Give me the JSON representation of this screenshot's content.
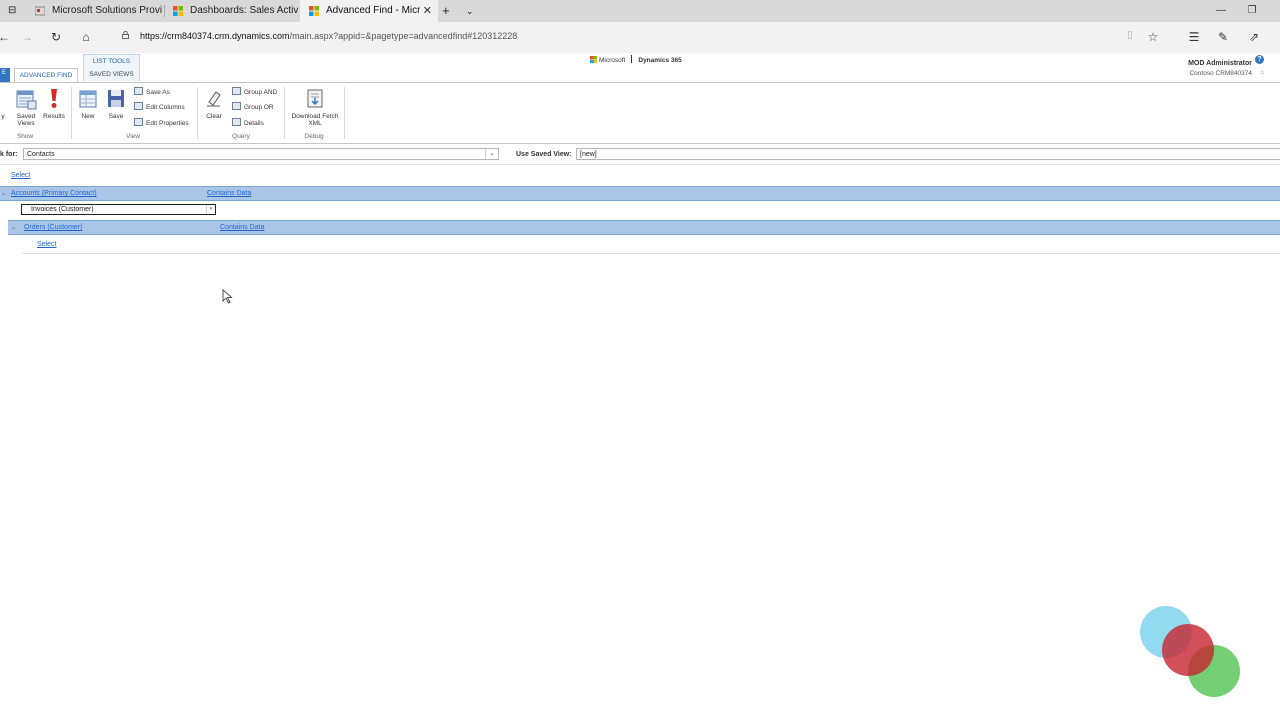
{
  "browser": {
    "tabs": [
      {
        "title": "Microsoft Solutions Provide",
        "active": false
      },
      {
        "title": "Dashboards: Sales Activity D",
        "active": false
      },
      {
        "title": "Advanced Find - Micros",
        "active": true
      }
    ],
    "url_host": "https://crm840374.crm.dynamics.com",
    "url_path": "/main.aspx?appid=&pagetype=advancedfind#120312228"
  },
  "header": {
    "brand_ms": "Microsoft",
    "brand_app": "Dynamics 365",
    "user_name": "MOD Administrator",
    "user_org": "Contoso CRM840374",
    "help": "?"
  },
  "ribbon": {
    "context_title": "LIST TOOLS",
    "context_tab": "SAVED VIEWS",
    "active_tab": "ADVANCED FIND",
    "file_tab": "E",
    "show": {
      "label": "Show",
      "partial": "y",
      "saved_views": "Saved Views",
      "results": "Results"
    },
    "view": {
      "label": "View",
      "new": "New",
      "save": "Save",
      "save_as": "Save As",
      "edit_columns": "Edit Columns",
      "edit_properties": "Edit Properties"
    },
    "query": {
      "label": "Query",
      "clear": "Clear",
      "group_and": "Group AND",
      "group_or": "Group OR",
      "details": "Details"
    },
    "debug": {
      "label": "Debug",
      "download_fetch": "Download Fetch XML"
    }
  },
  "look_for": {
    "label": "k for:",
    "value": "Contacts"
  },
  "saved_view": {
    "label": "Use Saved View:",
    "value": "[new]"
  },
  "query": {
    "top_select": "Select",
    "row1": {
      "field": "Accounts (Primary Contact)",
      "operator": "Contains Data"
    },
    "invoice_value": "Invoices (Customer)",
    "row2": {
      "field": "Orders (Customer)",
      "operator": "Contains Data"
    },
    "sub_select": "Select"
  },
  "colors": {
    "accent": "#2f77c6",
    "row_highlight": "#a9c6e8",
    "link": "#2266cc"
  }
}
